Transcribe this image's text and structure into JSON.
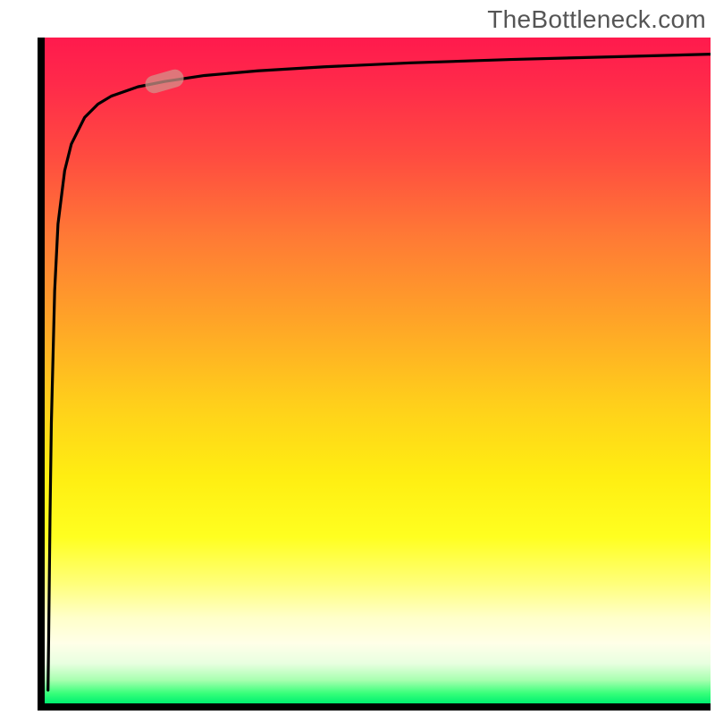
{
  "watermark": "TheBottleneck.com",
  "colors": {
    "frame": "#000000",
    "curve": "#000000",
    "marker": "rgba(210,150,140,0.72)",
    "gradient_top": "#ff1a4d",
    "gradient_bottom": "#00f070"
  },
  "chart_data": {
    "type": "line",
    "title": "",
    "xlabel": "",
    "ylabel": "",
    "xlim": [
      0,
      100
    ],
    "ylim": [
      0,
      100
    ],
    "grid": false,
    "series": [
      {
        "name": "curve",
        "x": [
          0.5,
          0.6,
          0.8,
          1.0,
          1.5,
          2.0,
          3.0,
          4.0,
          6.0,
          8.0,
          10.0,
          14.0,
          18.0,
          24.0,
          32.0,
          42.0,
          55.0,
          70.0,
          85.0,
          100.0
        ],
        "y": [
          2.0,
          10.0,
          28.0,
          42.0,
          62.0,
          72.0,
          80.0,
          84.0,
          88.0,
          90.0,
          91.2,
          92.6,
          93.4,
          94.3,
          95.0,
          95.6,
          96.2,
          96.7,
          97.1,
          97.5
        ]
      }
    ],
    "marker": {
      "x": 18.0,
      "y": 93.4,
      "angle_deg": -16
    }
  }
}
